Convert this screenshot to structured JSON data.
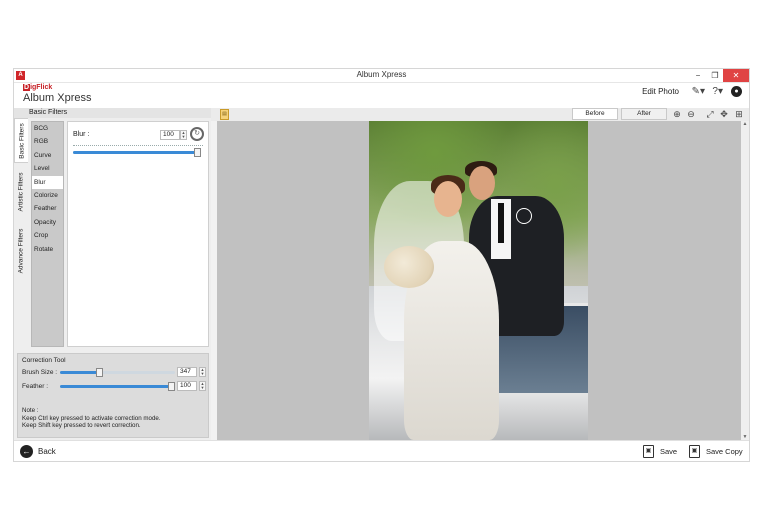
{
  "window": {
    "title": "Album Xpress",
    "min": "−",
    "max": "❐",
    "close": "✕"
  },
  "header": {
    "logo": "igFlick",
    "logo_initial": "D",
    "app_name": "Album Xpress",
    "mode_title": "Edit Photo"
  },
  "left_panel": {
    "section_title": "Basic Filters",
    "tabs": [
      "Basic Filters",
      "Artistic Filters",
      "Advance Filters"
    ],
    "active_tab": "Basic Filters",
    "filters": [
      "BCG",
      "RGB",
      "Curve",
      "Level",
      "Blur",
      "Colorize",
      "Feather",
      "Opacity",
      "Crop",
      "Rotate"
    ],
    "active_filter": "Blur",
    "blur": {
      "label": "Blur :",
      "value": "100",
      "level": 1.0
    },
    "correction_tool": {
      "title": "Correction Tool",
      "brush_size": {
        "label": "Brush Size :",
        "value": "347",
        "level": 0.34
      },
      "feather": {
        "label": "Feather :",
        "value": "100",
        "level": 1.0
      },
      "notes": [
        "Note :",
        "Keep Ctrl key pressed to activate correction mode.",
        "Keep Shift key pressed to revert correction."
      ]
    }
  },
  "canvas": {
    "before_label": "Before",
    "after_label": "After"
  },
  "bottom": {
    "back_label": "Back",
    "save_label": "Save",
    "save_copy_label": "Save Copy"
  },
  "colors": {
    "accent": "#3a8ad6",
    "close": "#e04343",
    "brand": "#c72127"
  }
}
